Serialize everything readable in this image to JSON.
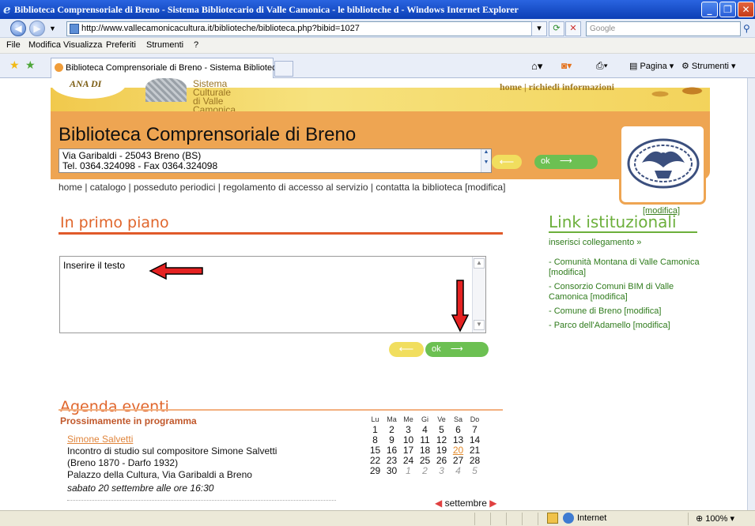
{
  "window": {
    "title": "Biblioteca Comprensoriale di Breno - Sistema Bibliotecario di Valle Camonica - le biblioteche d - Windows Internet Explorer"
  },
  "addressbar": {
    "url": "http://www.vallecamonicacultura.it/biblioteche/biblioteca.php?bibid=1027",
    "search_placeholder": "Google"
  },
  "menu": {
    "items": [
      "File",
      "Modifica",
      "Visualizza",
      "Preferiti",
      "Strumenti",
      "?"
    ]
  },
  "tabs": {
    "active_label": "Biblioteca Comprensoriale di Breno - Sistema Biblioteca..."
  },
  "toolbar": {
    "pagina": "Pagina",
    "strumenti": "Strumenti"
  },
  "site": {
    "emblem_text": "ANA DI",
    "system_line1": "Sistema Culturale",
    "system_line2": "di Valle Camonica",
    "top_links": "home | richiedi informazioni",
    "library_title": "Biblioteca Comprensoriale di Breno",
    "address_line1": "Via Garibaldi - 25043 Breno (BS)",
    "address_line2": "Tel. 0364.324098 - Fax 0364.324098",
    "ok_label": "ok",
    "nav": "home | catalogo | posseduto periodici | regolamento di accesso al servizio | contatta la biblioteca [modifica]",
    "modifica_photo": "[modifica]"
  },
  "primo_piano": {
    "heading": "In primo piano",
    "textarea_value": "Inserire il testo",
    "ok_label": "ok"
  },
  "link_istituzionali": {
    "heading": "Link istituzionali",
    "add": "inserisci collegamento »",
    "items": [
      "- Comunità Montana di Valle Camonica [modifica]",
      "- Consorzio Comuni BIM di Valle Camonica [modifica]",
      "- Comune di Breno [modifica]",
      "- Parco dell'Adamello [modifica]"
    ]
  },
  "agenda": {
    "heading": "Agenda eventi",
    "subheading": "Prossimamente in programma",
    "event_title": "Simone Salvetti",
    "event_line1": "Incontro di studio sul compositore Simone Salvetti",
    "event_line2": "(Breno 1870 - Darfo 1932)",
    "event_line3": "Palazzo della Cultura, Via Garibaldi a Breno",
    "event_date": "sabato 20 settembre alle ore 16:30",
    "calendar": {
      "days": [
        "Lu",
        "Ma",
        "Me",
        "Gi",
        "Ve",
        "Sa",
        "Do"
      ],
      "weeks": [
        [
          "1",
          "2",
          "3",
          "4",
          "5",
          "6",
          "7"
        ],
        [
          "8",
          "9",
          "10",
          "11",
          "12",
          "13",
          "14"
        ],
        [
          "15",
          "16",
          "17",
          "18",
          "19",
          "20",
          "21"
        ],
        [
          "22",
          "23",
          "24",
          "25",
          "26",
          "27",
          "28"
        ],
        [
          "29",
          "30",
          "1",
          "2",
          "3",
          "4",
          "5"
        ]
      ],
      "today": "20",
      "month": "settembre"
    }
  },
  "statusbar": {
    "zone": "Internet",
    "zoom": "100%"
  }
}
